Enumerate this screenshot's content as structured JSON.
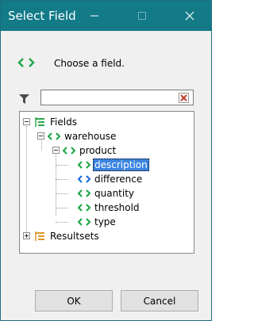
{
  "window": {
    "title": "Select Field"
  },
  "header": {
    "text": "Choose a field."
  },
  "filter": {
    "value": "",
    "placeholder": ""
  },
  "tree": {
    "fields_label": "Fields",
    "warehouse_label": "warehouse",
    "product_label": "product",
    "items": [
      {
        "label": "description",
        "icon": "field-green-icon",
        "selected": true
      },
      {
        "label": "difference",
        "icon": "field-blue-icon",
        "selected": false
      },
      {
        "label": "quantity",
        "icon": "field-green-icon",
        "selected": false
      },
      {
        "label": "threshold",
        "icon": "field-green-icon",
        "selected": false
      },
      {
        "label": "type",
        "icon": "field-green-icon",
        "selected": false
      }
    ],
    "resultsets_label": "Resultsets"
  },
  "buttons": {
    "ok": "OK",
    "cancel": "Cancel"
  },
  "colors": {
    "titlebar": "#137a88",
    "field_green": "#22a84a",
    "field_blue": "#1e6fd9",
    "selection": "#3b85e0",
    "clear_red": "#c0392b"
  }
}
